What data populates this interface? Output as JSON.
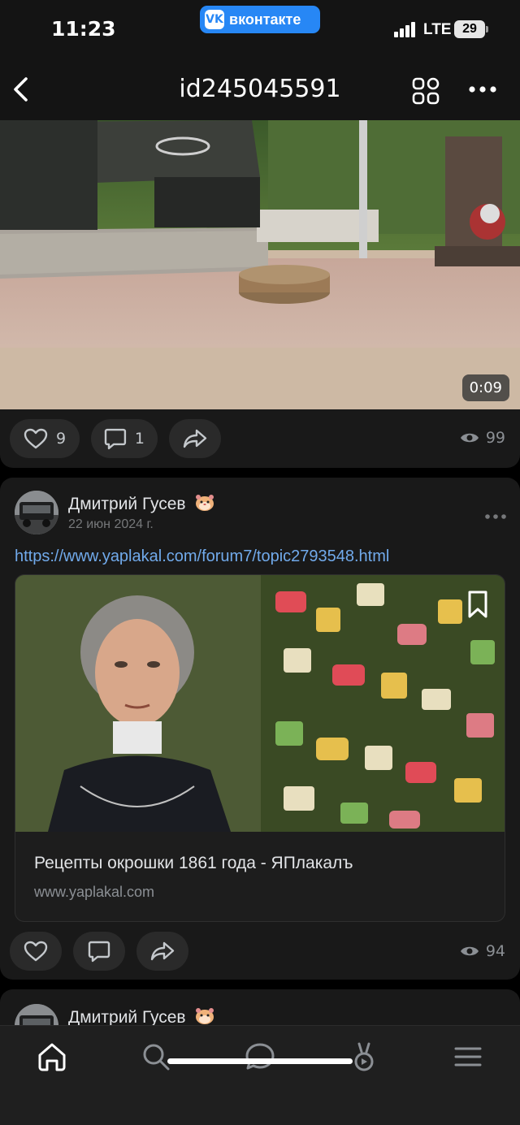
{
  "status_bar": {
    "time": "11:23",
    "app_badge": "вконтакте",
    "vk_logo": "VK",
    "network": "LTE",
    "battery": "29"
  },
  "nav": {
    "title": "id245045591",
    "back_icon": "chevron-left-icon",
    "grid_icon": "grid-icon",
    "more_icon": "more-horizontal-icon"
  },
  "video_post": {
    "duration": "0:09",
    "likes": "9",
    "comments": "1",
    "views": "99"
  },
  "link_post": {
    "author": "Дмитрий Гусев",
    "date": "22 июн 2024 г.",
    "link": "https://www.yaplakal.com/forum7/topic2793548.html",
    "preview_title": "Рецепты окрошки 1861 года - ЯПлакалъ",
    "preview_domain": "www.yaplakal.com",
    "views": "94"
  },
  "next_post": {
    "author": "Дмитрий Гусев"
  },
  "tabs": [
    {
      "icon": "home-icon"
    },
    {
      "icon": "search-icon"
    },
    {
      "icon": "messages-icon"
    },
    {
      "icon": "clips-icon"
    },
    {
      "icon": "menu-icon"
    }
  ],
  "colors": {
    "accent": "#2787f5",
    "link": "#71aaeb",
    "background": "#000000",
    "card": "#191919"
  }
}
